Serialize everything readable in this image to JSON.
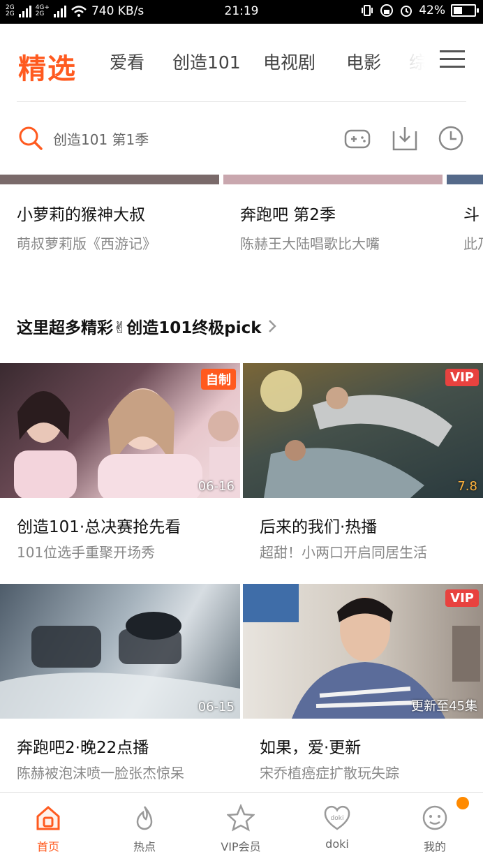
{
  "status_bar": {
    "network_1": "2G",
    "network_2": "4G+",
    "network_3": "2G",
    "speed": "740 KB/s",
    "time": "21:19",
    "battery_text": "42%",
    "battery_level": 0.42
  },
  "nav": {
    "logo": "精选",
    "tabs": [
      "爱看",
      "创造101",
      "电视剧",
      "电影",
      "综"
    ]
  },
  "search": {
    "placeholder": "创造101 第1季"
  },
  "top_row": [
    {
      "title": "小萝莉的猴神大叔",
      "subtitle": "萌叔萝莉版《西游记》"
    },
    {
      "title": "奔跑吧 第2季",
      "subtitle": "陈赫王大陆唱歌比大嘴"
    },
    {
      "title": "斗",
      "subtitle": "此乃"
    }
  ],
  "section": {
    "title": "这里超多精彩✌创造101终极pick"
  },
  "cards": [
    {
      "title": "创造101·总决赛抢先看",
      "subtitle": "101位选手重聚开场秀",
      "badge": "自制",
      "badge_color": "#ff5a1f",
      "corner": "06-16"
    },
    {
      "title": "后来的我们·热播",
      "subtitle": "超甜！小两口开启同居生活",
      "badge": "VIP",
      "badge_color": "#e8423f",
      "corner": "7.8"
    },
    {
      "title": "奔跑吧2·晚22点播",
      "subtitle": "陈赫被泡沫喷一脸张杰惊呆",
      "badge": "",
      "badge_color": "",
      "corner": "06-15"
    },
    {
      "title": "如果，爱·更新",
      "subtitle": "宋乔植癌症扩散玩失踪",
      "badge": "VIP",
      "badge_color": "#e8423f",
      "corner": "更新至45集"
    }
  ],
  "bottom_nav": [
    {
      "label": "首页",
      "icon": "home-icon"
    },
    {
      "label": "热点",
      "icon": "flame-icon"
    },
    {
      "label": "VIP会员",
      "icon": "vip-star-icon"
    },
    {
      "label": "doki",
      "icon": "doki-heart-icon"
    },
    {
      "label": "我的",
      "icon": "profile-icon"
    }
  ],
  "colors": {
    "accent": "#ff5a1f",
    "vip": "#e8423f",
    "notification": "#ff8a00"
  }
}
